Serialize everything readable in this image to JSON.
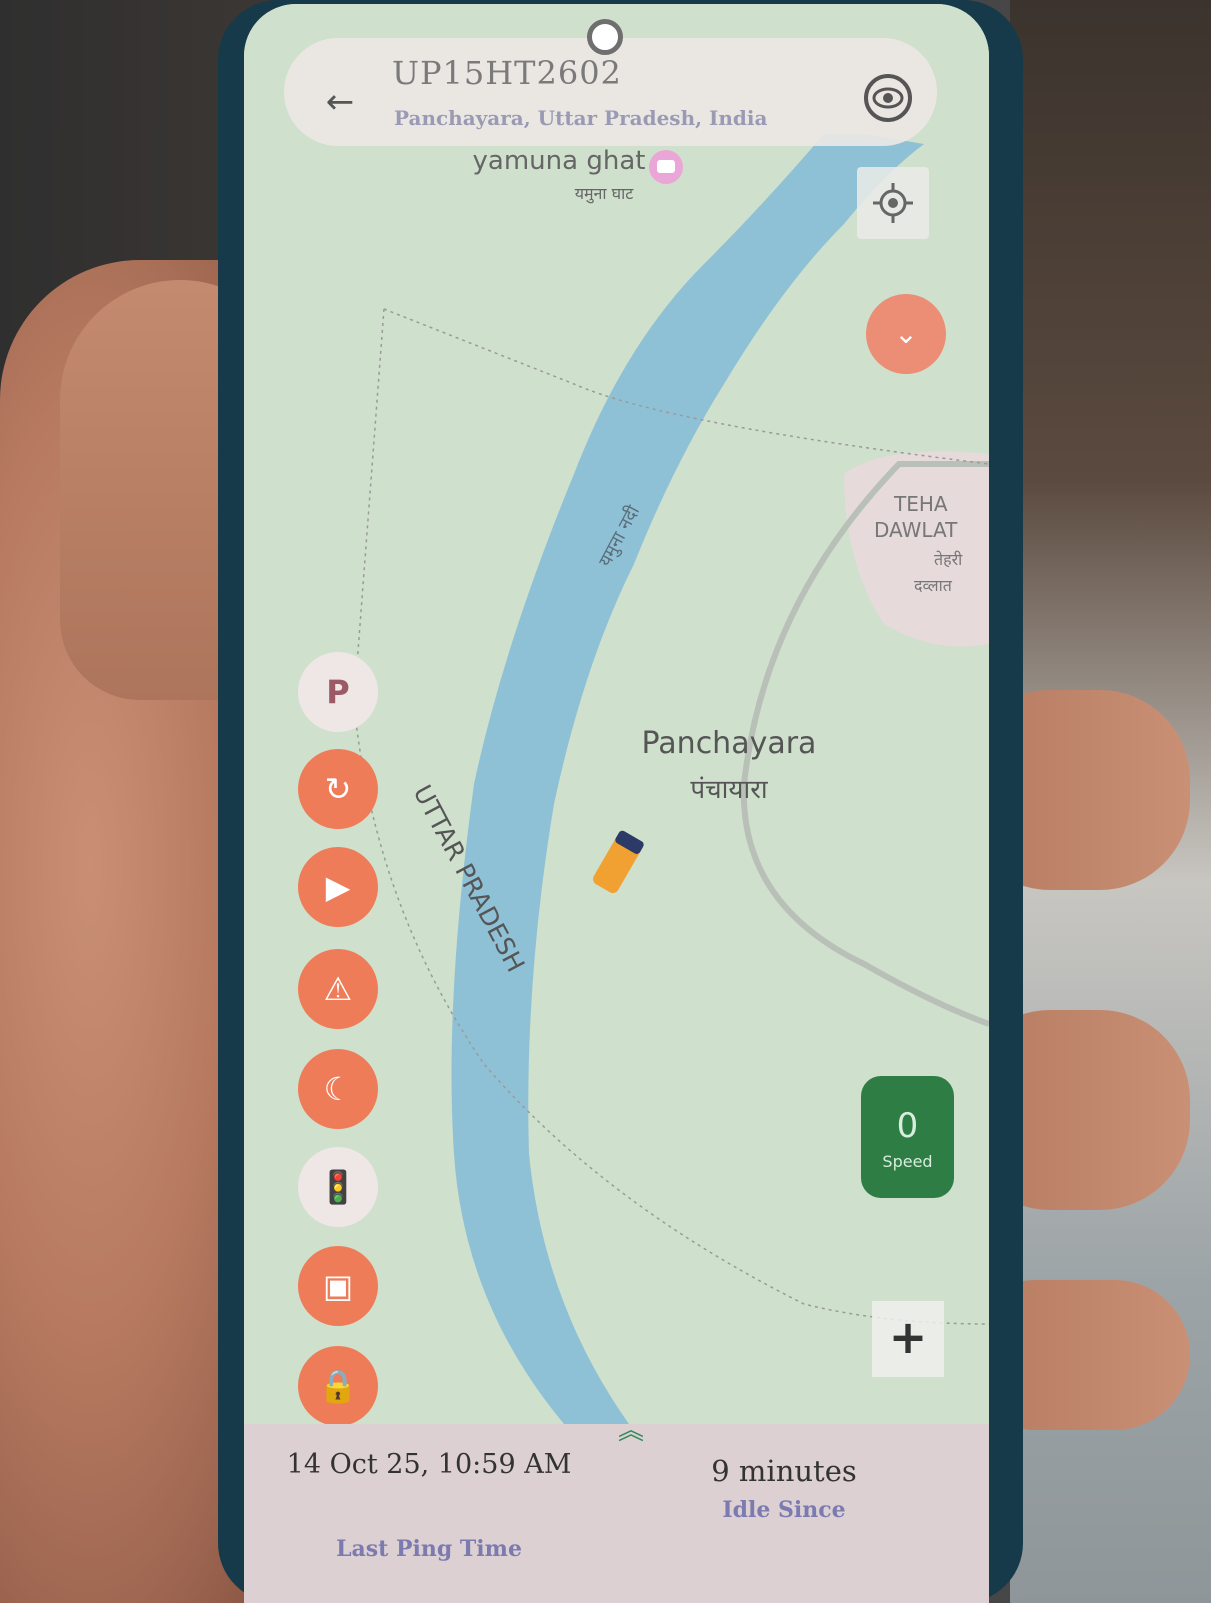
{
  "header": {
    "vehicle_number": "UP15HT2602",
    "location": "Panchayara, Uttar Pradesh, India"
  },
  "map": {
    "poi_label_en": "yamuna ghat",
    "poi_label_hi": "यमुना घाट",
    "river_label": "यमुना नदी",
    "village_label_en": "Panchayara",
    "village_label_hi": "पंचायारा",
    "state_label": "UTTAR PRADESH",
    "tehsil_label_1": "TEHA",
    "tehsil_label_2": "DAWLAT",
    "tehsil_label_hi_1": "तेहरी",
    "tehsil_label_hi_2": "दव्लात"
  },
  "side_buttons": [
    {
      "name": "parking-icon",
      "glyph": "P"
    },
    {
      "name": "refresh-icon",
      "glyph": "↻"
    },
    {
      "name": "play-icon",
      "glyph": "▶"
    },
    {
      "name": "alert-icon",
      "glyph": "⚠"
    },
    {
      "name": "night-mode-icon",
      "glyph": "☾"
    },
    {
      "name": "traffic-light-icon",
      "glyph": "🚦"
    },
    {
      "name": "image-icon",
      "glyph": "▣"
    },
    {
      "name": "lock-icon",
      "glyph": "🔒"
    }
  ],
  "speed": {
    "value": "0",
    "label": "Speed"
  },
  "zoom": {
    "in_label": "+"
  },
  "status": {
    "last_ping_value": "14 Oct 25, 10:59 AM",
    "last_ping_label": "Last Ping Time",
    "idle_value": "9 minutes",
    "idle_label": "Idle Since"
  },
  "colors": {
    "map_land": "#cfe0cd",
    "river": "#8fc1d6",
    "fab_orange": "#ef7c58",
    "speed_green": "#2e7d45",
    "label_purple": "#7b7bb0"
  }
}
